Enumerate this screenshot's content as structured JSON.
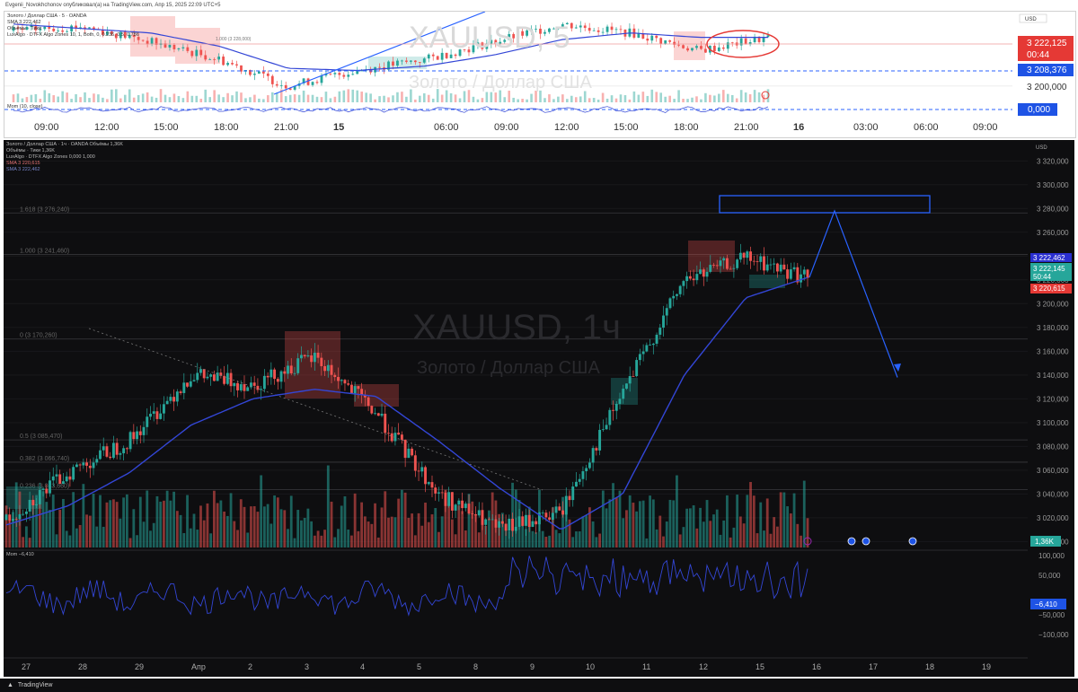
{
  "header": {
    "publisher": "Evgenii_Novokhchonov опубликовал(а) на TradingView.com, Апр 15, 2025 22:09 UTC+5"
  },
  "top_chart": {
    "watermark_symbol": "XAUUSD, 5",
    "watermark_name": "Золото / Доллар США",
    "currency": "USD",
    "legend": [
      "Золото / Доллар США · 5 · OANDA",
      "SMA 3 222,462",
      "Объёмы · Тики",
      "LuxAlgo · DTFX Algo Zones 10, 1, Both, 0, 0.236, 0.5, 0.786",
      "Mom (10, close)"
    ],
    "price_labels": [
      "3 222,125",
      "00:44",
      "3 208,376",
      "3 200,000",
      "0,000"
    ],
    "x_labels": [
      "09:00",
      "12:00",
      "15:00",
      "18:00",
      "21:00",
      "15",
      "06:00",
      "09:00",
      "12:00",
      "15:00",
      "18:00",
      "21:00",
      "16",
      "03:00",
      "06:00",
      "09:00"
    ],
    "fib_label": "1.000 (3 228,000)"
  },
  "bottom_chart": {
    "watermark_symbol": "XAUUSD, 1ч",
    "watermark_name": "Золото / Доллар США",
    "currency": "USD",
    "legend": [
      "Золото / Доллар США · 1ч · OANDA  Объёмы 1,36K",
      "Объёмы · Тики 1,36K",
      "LuxAlgo · DTFX Algo Zones 0,000 1,000",
      "SMA 3 220,615",
      "SMA 3 222,462"
    ],
    "fib_labels": [
      "1.618 (3 276,240)",
      "1.000 (3 241,460)",
      "0 (3 170,260)",
      "0.5 (3 085,470)",
      "0.382 (3 066,740)",
      "0.236 (3 043,660)"
    ],
    "price_tag_blue": "3 222,462",
    "price_tag_green": "3 222,145",
    "price_tag_green_sub": "50:44",
    "price_tag_red": "3 220,615",
    "volume_tag": "1,36K",
    "mom_legend": "Mom  −6,410",
    "mom_tag": "−6,410",
    "x_labels": [
      "27",
      "28",
      "29",
      "Апр",
      "2",
      "3",
      "4",
      "5",
      "8",
      "9",
      "10",
      "11",
      "12",
      "15",
      "16",
      "17",
      "18",
      "19"
    ]
  },
  "footer": {
    "brand": "TradingView"
  },
  "colors": {
    "up": "#26a69a",
    "down": "#ef5350",
    "sma": "#3346d6",
    "drawing": "#2962ff",
    "annotation": "#e53935"
  },
  "chart_data": [
    {
      "type": "line",
      "title": "XAUUSD, 5",
      "ylabel": "USD",
      "ylim": [
        3193,
        3232
      ],
      "y_ticks": [
        3200
      ],
      "x": [
        "09:00",
        "12:00",
        "15:00",
        "18:00",
        "21:00",
        "15",
        "06:00",
        "09:00",
        "12:00",
        "15:00",
        "18:00",
        "21:00"
      ],
      "series": [
        {
          "name": "Close",
          "values": [
            3225,
            3227,
            3220,
            3212,
            3200,
            3207,
            3212,
            3220,
            3228,
            3224,
            3216,
            3222
          ]
        },
        {
          "name": "SMA",
          "values": [
            3228,
            3226,
            3224,
            3218,
            3208,
            3207,
            3209,
            3214,
            3221,
            3224,
            3222,
            3222
          ]
        }
      ],
      "last_price": 3222.125,
      "level": 3208.376,
      "mom_last": 0.0
    },
    {
      "type": "line",
      "title": "XAUUSD, 1ч",
      "ylabel": "USD",
      "ylim": [
        2995,
        3330
      ],
      "y_ticks": [
        3000,
        3020,
        3040,
        3060,
        3080,
        3100,
        3120,
        3140,
        3160,
        3180,
        3200,
        3220,
        3240,
        3260,
        3280,
        3300,
        3320
      ],
      "x": [
        "27",
        "28",
        "29",
        "Апр",
        "2",
        "3",
        "4",
        "5",
        "8",
        "9",
        "10",
        "11",
        "12",
        "15"
      ],
      "series": [
        {
          "name": "Close",
          "values": [
            3018,
            3058,
            3085,
            3140,
            3132,
            3155,
            3108,
            3040,
            3010,
            3025,
            3125,
            3220,
            3238,
            3222
          ]
        },
        {
          "name": "SMA",
          "values": [
            3014,
            3030,
            3058,
            3098,
            3120,
            3128,
            3122,
            3085,
            3045,
            3010,
            3040,
            3140,
            3205,
            3222
          ]
        }
      ],
      "forecast_path": [
        3222,
        3278,
        3138
      ],
      "fib_levels": [
        3276.24,
        3241.46,
        3170.26,
        3085.47,
        3066.74,
        3043.66
      ],
      "last_price": 3222.145,
      "volume_last": "1,36K",
      "mom_last": -6.41,
      "mom_ticks": [
        100000,
        50000,
        -50000,
        -100000
      ]
    }
  ]
}
